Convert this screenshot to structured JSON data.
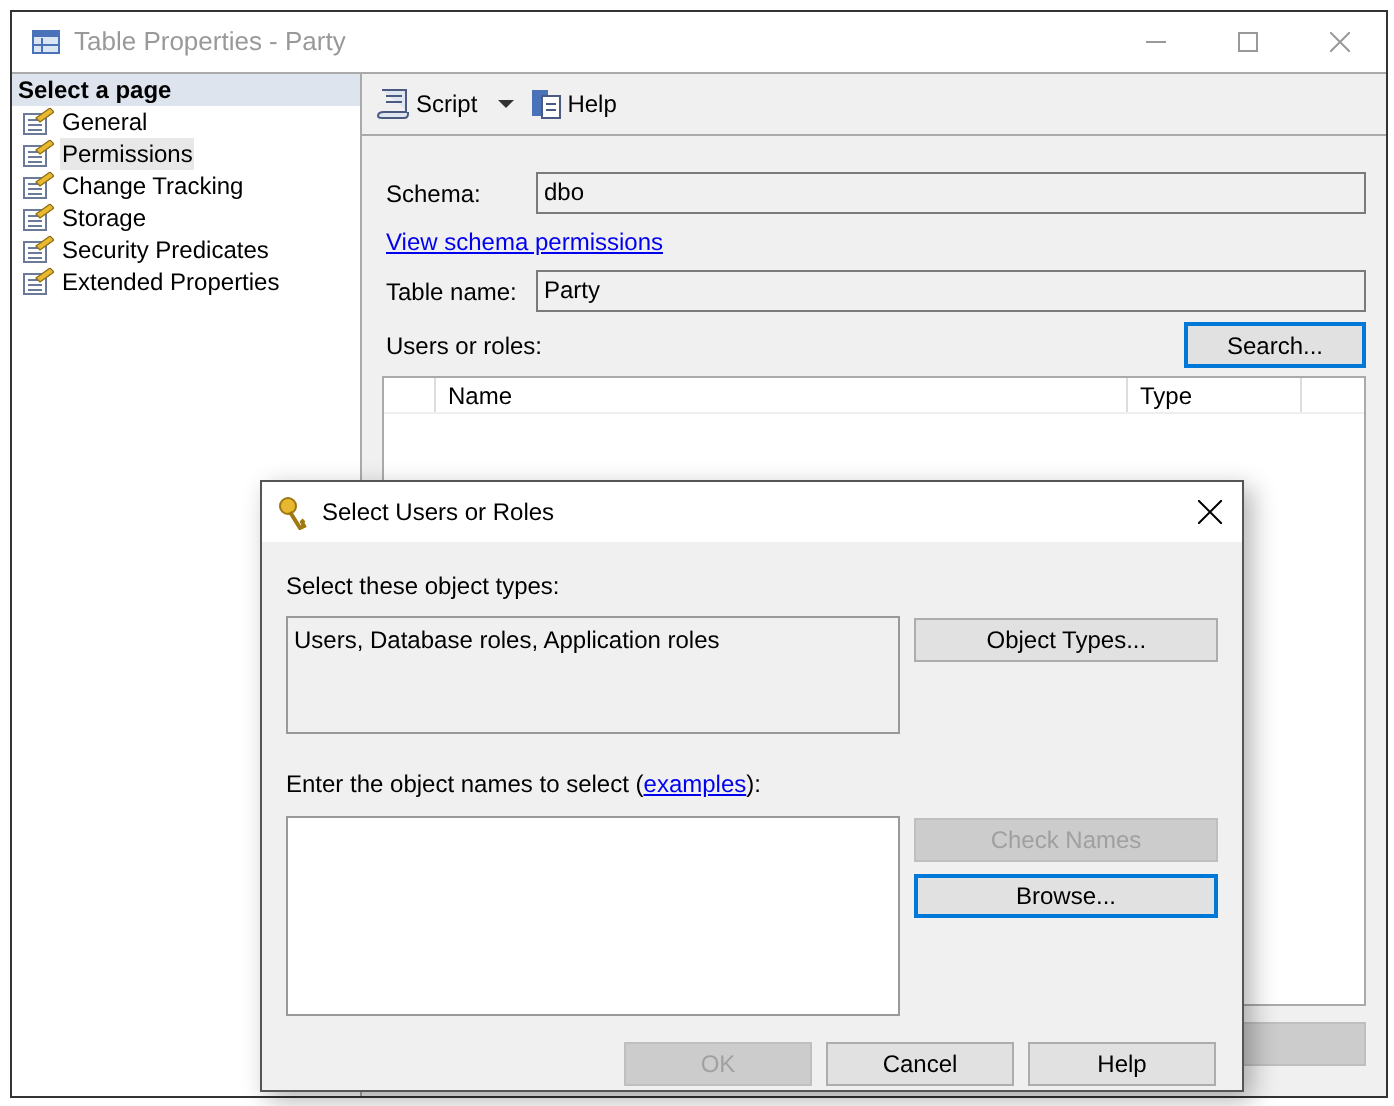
{
  "window": {
    "title": "Table Properties - Party"
  },
  "sidebar": {
    "heading": "Select a page",
    "items": [
      {
        "label": "General",
        "selected": false
      },
      {
        "label": "Permissions",
        "selected": true
      },
      {
        "label": "Change Tracking",
        "selected": false
      },
      {
        "label": "Storage",
        "selected": false
      },
      {
        "label": "Security Predicates",
        "selected": false
      },
      {
        "label": "Extended Properties",
        "selected": false
      }
    ]
  },
  "toolbar": {
    "script": "Script",
    "help": "Help"
  },
  "form": {
    "schema_label": "Schema:",
    "schema_value": "dbo",
    "schema_link": "View schema permissions",
    "table_label": "Table name:",
    "table_value": "Party",
    "users_label": "Users or roles:",
    "search_button": "Search..."
  },
  "table": {
    "columns": [
      "Name",
      "Type"
    ]
  },
  "dialog": {
    "title": "Select Users or Roles",
    "types_label": "Select these object types:",
    "types_value": "Users, Database roles, Application roles",
    "object_types_button": "Object Types...",
    "names_label": "Enter the object names to select (",
    "names_link": "examples",
    "names_label_end": "):",
    "buttons": [
      {
        "label": "Check Names",
        "disabled": true
      },
      {
        "label": "Browse...",
        "disabled": false
      }
    ],
    "footer": [
      {
        "label": "OK",
        "disabled": true
      },
      {
        "label": "Cancel",
        "disabled": false
      },
      {
        "label": "Help",
        "disabled": false
      }
    ]
  }
}
